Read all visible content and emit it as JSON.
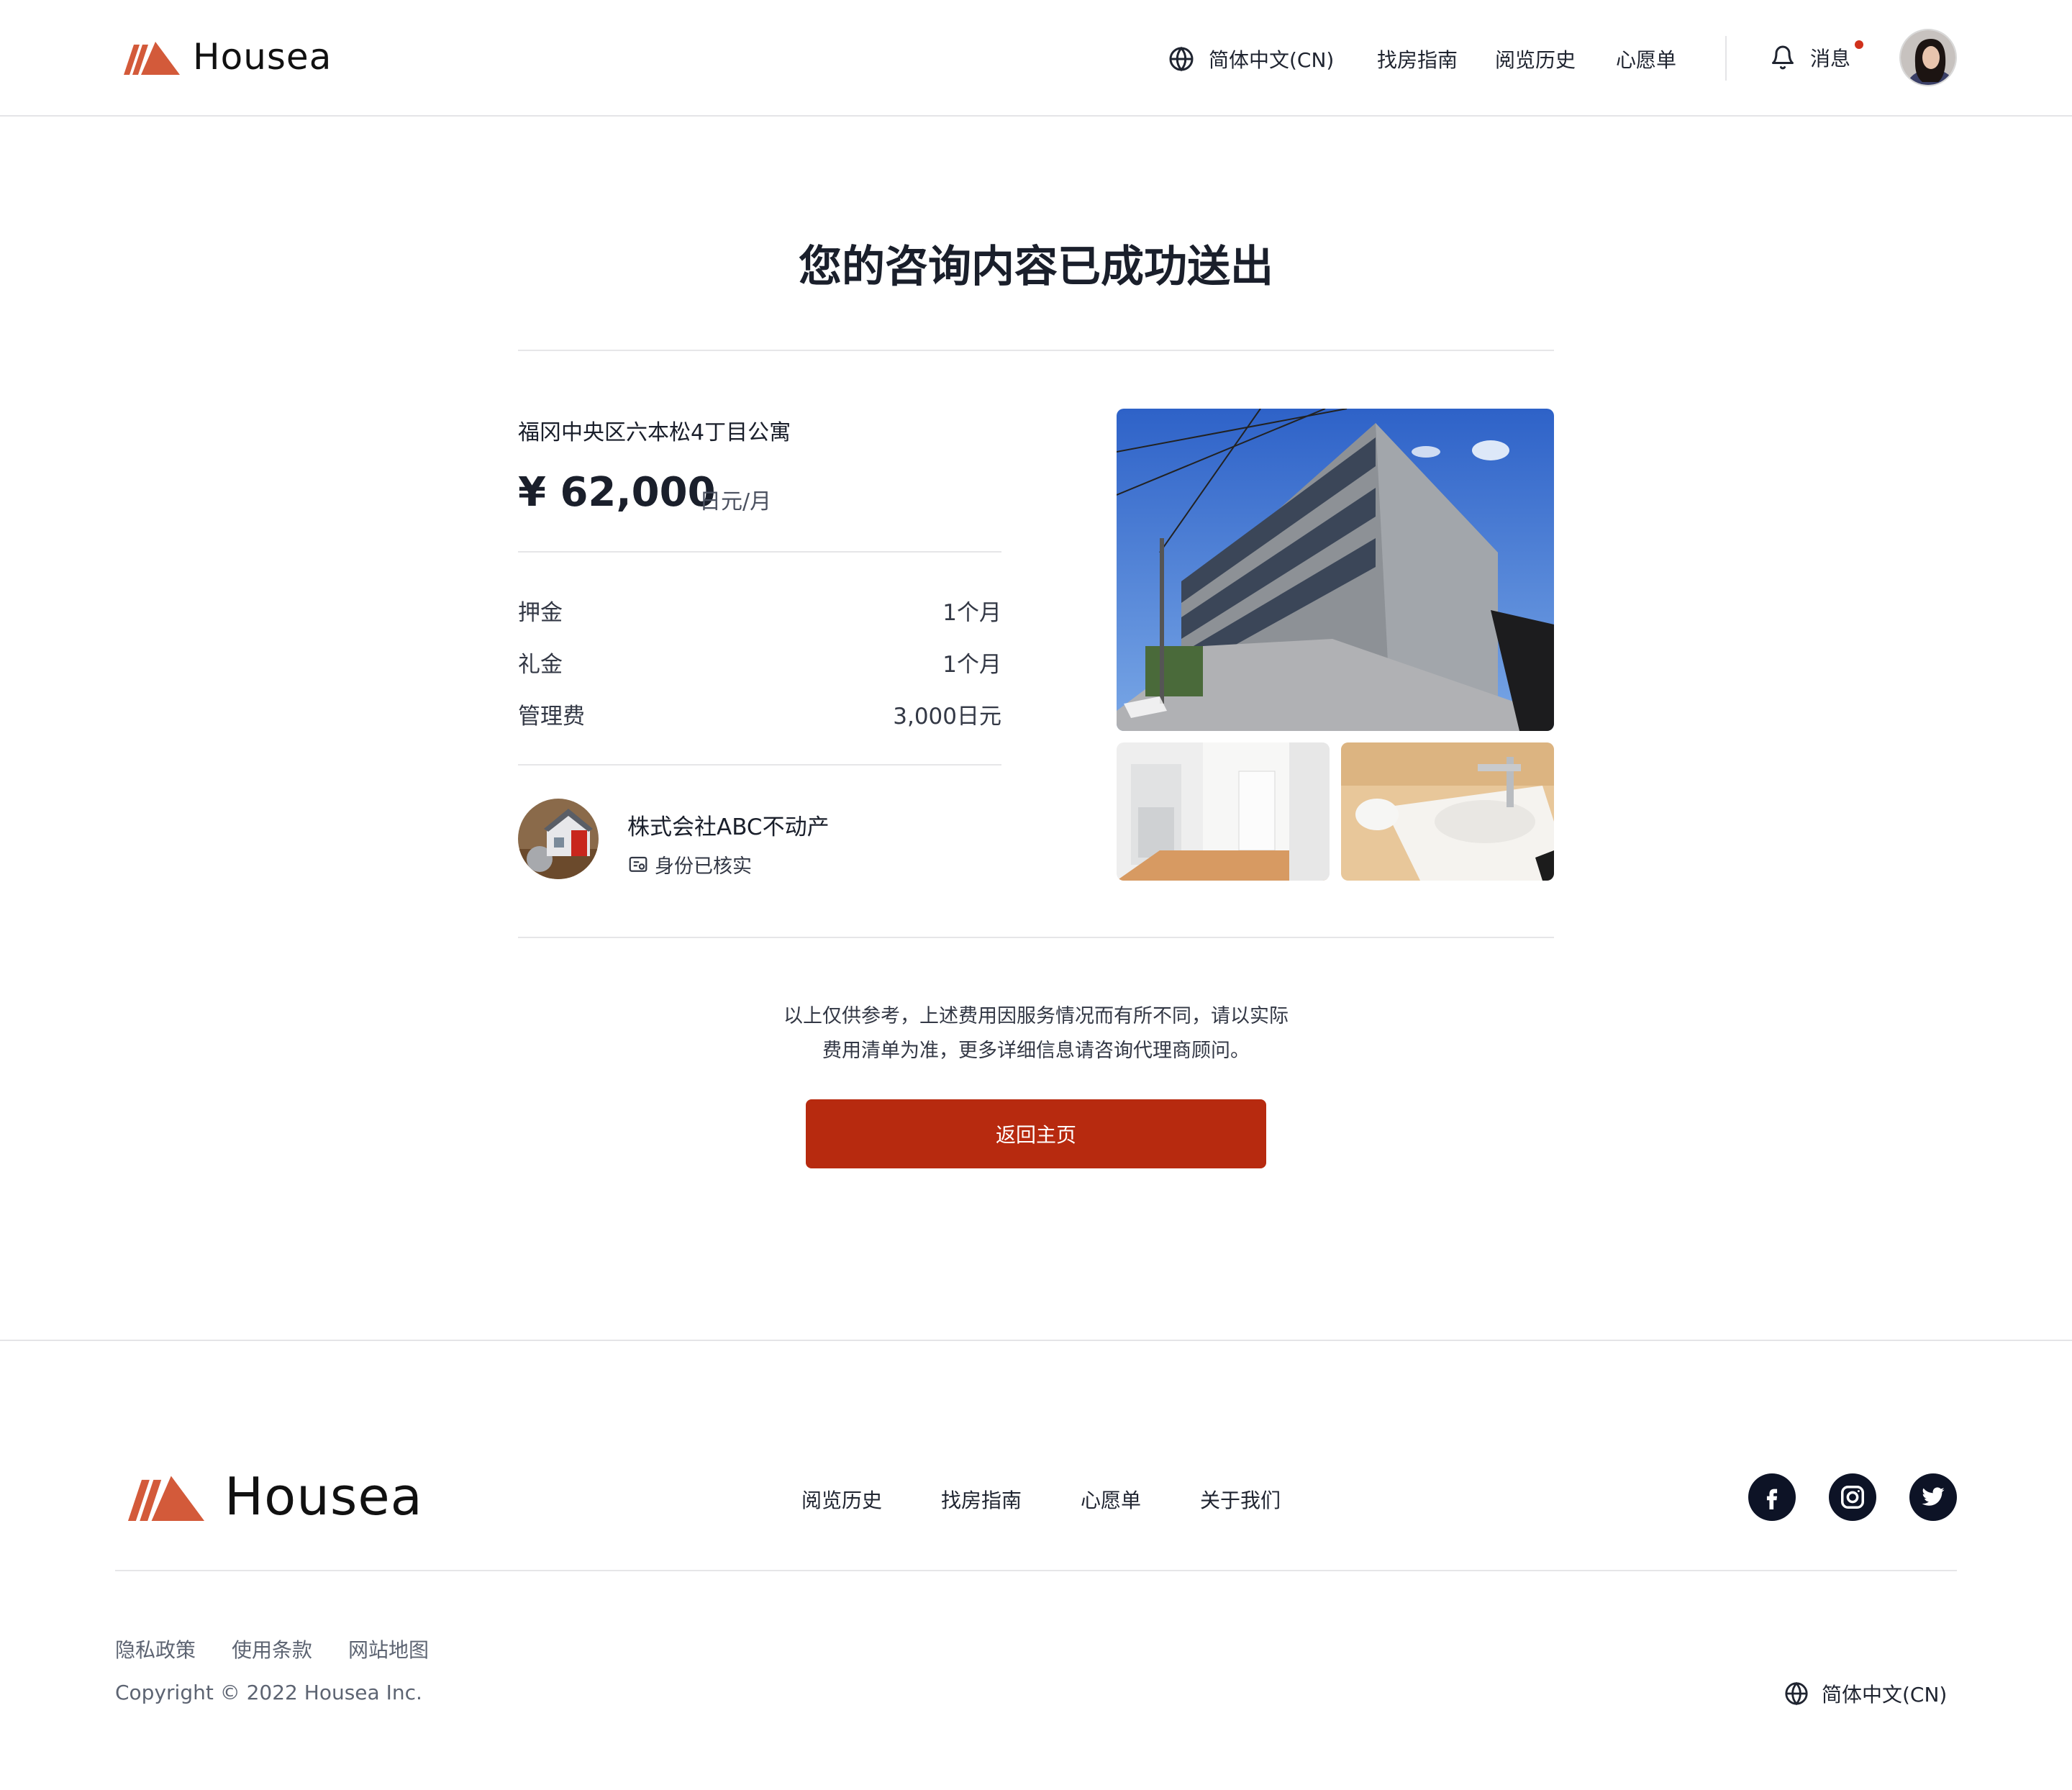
{
  "header": {
    "brand": "Housea",
    "language": "简体中文(CN)",
    "nav": [
      "找房指南",
      "阅览历史",
      "心愿单"
    ],
    "messages_label": "消息"
  },
  "main": {
    "title": "您的咨询内容已成功送出",
    "property": {
      "name": "福冈中央区六本松4丁目公寓",
      "price": "¥ 62,000",
      "price_unit": "日元/月",
      "fees": [
        {
          "label": "押金",
          "value": "1个月"
        },
        {
          "label": "礼金",
          "value": "1个月"
        },
        {
          "label": "管理费",
          "value": "3,000日元"
        }
      ]
    },
    "agent": {
      "name": "株式会社ABC不动产",
      "verified": "身份已核实"
    },
    "notice_line1": "以上仅供参考，上述费用因服务情况而有所不同，请以实际",
    "notice_line2": "费用清单为准，更多详细信息请咨询代理商顾问。",
    "back_button": "返回主页"
  },
  "footer": {
    "brand": "Housea",
    "nav": [
      "阅览历史",
      "找房指南",
      "心愿单",
      "关于我们"
    ],
    "social": [
      "facebook-icon",
      "instagram-icon",
      "twitter-icon"
    ],
    "legal": [
      "隐私政策",
      "使用条款",
      "网站地图"
    ],
    "copyright": "Copyright © 2022 Housea Inc.",
    "language": "简体中文(CN)"
  },
  "colors": {
    "brand": "#d35a3a",
    "button": "#b72a0f",
    "notification_dot": "#d0311b",
    "social_bg": "#0d1326"
  }
}
